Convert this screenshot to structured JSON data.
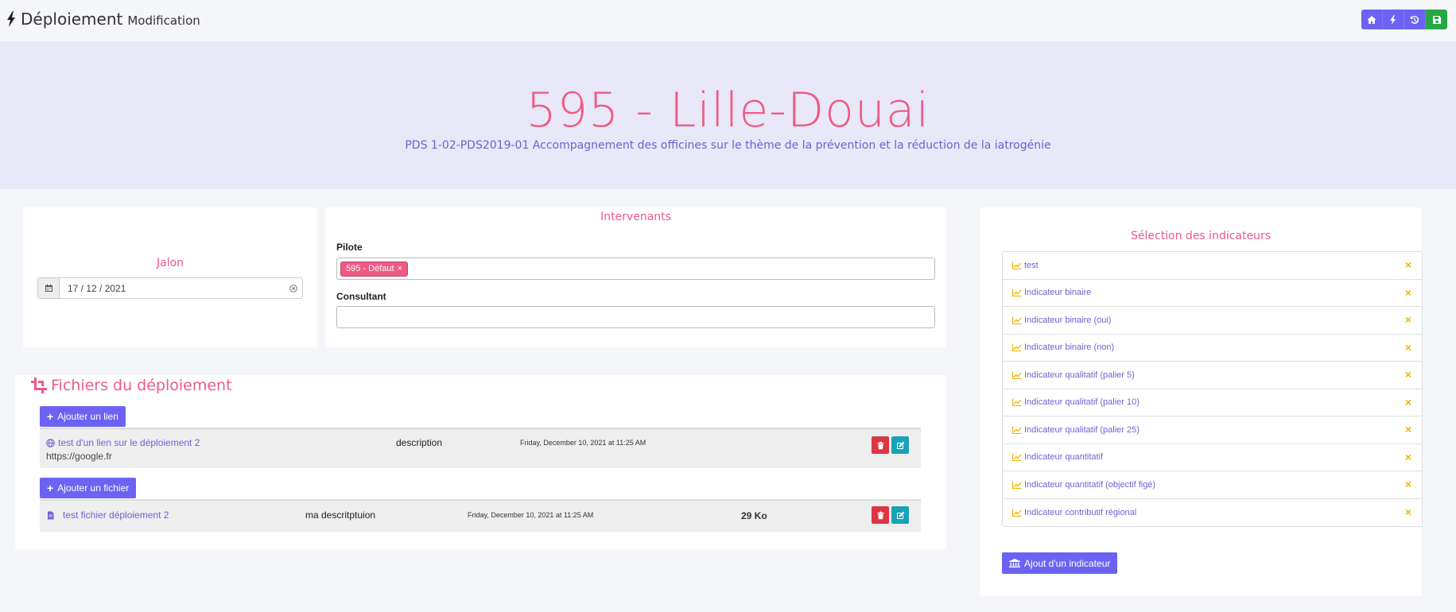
{
  "header": {
    "title": "Déploiement",
    "subtitle": "Modification",
    "title_icon": "bolt-icon",
    "toolbar": [
      {
        "icon": "home-icon"
      },
      {
        "icon": "bolt-icon"
      },
      {
        "icon": "history-icon"
      },
      {
        "icon": "save-icon"
      }
    ]
  },
  "hero": {
    "title": "595 - Lille-Douai",
    "subtitle": "PDS 1-02-PDS2019-01 Accompagnement des officines sur le thème de la prévention et la réduction de la iatrogénie"
  },
  "jalon": {
    "title": "Jalon",
    "date": "17 / 12 / 2021"
  },
  "intervenants": {
    "title": "Intervenants",
    "pilote_label": "Pilote",
    "pilote_tag": "595 - Défaut",
    "pilote_tag_remove": "×",
    "consultant_label": "Consultant",
    "consultant_value": ""
  },
  "files": {
    "title": "Fichiers du déploiement",
    "add_link_label": "Ajouter un lien",
    "add_file_label": "Ajouter un fichier",
    "links": [
      {
        "name": "test d'un lien sur le déploiement 2",
        "url": "https://google.fr",
        "description": "description",
        "date": "Friday, December 10, 2021 at 11:25 AM"
      }
    ],
    "documents": [
      {
        "name": "test fichier déploiement 2",
        "description": "ma descritptuion",
        "date": "Friday, December 10, 2021 at 11:25 AM",
        "size": "29 Ko"
      }
    ]
  },
  "indicators": {
    "title": "Sélection des indicateurs",
    "add_label": "Ajout d'un indicateur",
    "remove_glyph": "×",
    "items": [
      "test",
      "Indicateur binaire",
      "Indicateur binaire (oui)",
      "Indicateur binaire (non)",
      "Indicateur qualitatif (palier 5)",
      "Indicateur qualitatif (palier 10)",
      "Indicateur qualitatif (palier 25)",
      "Indicateur quantitatif",
      "Indicateur quantitatif (objectif figé)",
      "Indicateur contributif régional"
    ]
  },
  "colors": {
    "accent": "#6c63f4",
    "pink": "#f05a84",
    "hero_bg": "#e8e8f8",
    "success": "#28a745",
    "danger": "#dc3545",
    "info": "#17a2b8",
    "warning": "#f0b400"
  }
}
